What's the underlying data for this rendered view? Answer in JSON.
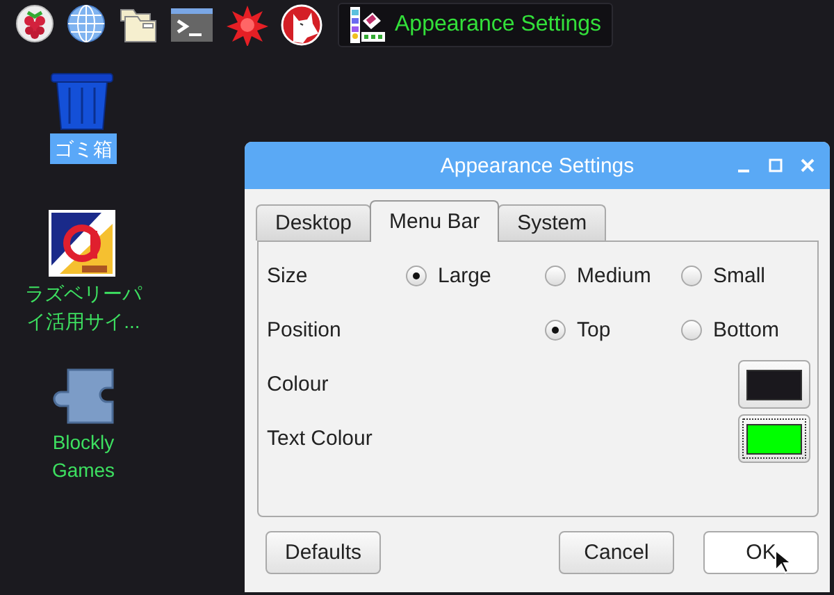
{
  "taskbar": {
    "task": {
      "title": "Appearance Settings"
    }
  },
  "desktop_icons": [
    {
      "label": "ゴミ箱",
      "selected": true
    },
    {
      "label": "ラズベリーパイ活用サイ...",
      "selected": false
    },
    {
      "label": "Blockly Games",
      "selected": false
    }
  ],
  "window": {
    "title": "Appearance Settings",
    "tabs": [
      {
        "label": "Desktop",
        "selected": false
      },
      {
        "label": "Menu Bar",
        "selected": true
      },
      {
        "label": "System",
        "selected": false
      }
    ],
    "rows": [
      {
        "label": "Size",
        "kind": "radio",
        "options": [
          {
            "label": "Large",
            "selected": true
          },
          {
            "label": "Medium",
            "selected": false
          },
          {
            "label": "Small",
            "selected": false
          }
        ]
      },
      {
        "label": "Position",
        "kind": "radio",
        "options": [
          {
            "label": "Top",
            "selected": true
          },
          {
            "label": "Bottom",
            "selected": false
          }
        ]
      },
      {
        "label": "Colour",
        "kind": "color",
        "color": "#1a181d",
        "focused": false
      },
      {
        "label": "Text Colour",
        "kind": "color",
        "color": "#00ff00",
        "focused": true
      }
    ],
    "buttons": [
      {
        "label": "Defaults",
        "highlighted": false
      },
      {
        "label": "Cancel",
        "highlighted": false
      },
      {
        "label": "OK",
        "highlighted": true
      }
    ]
  }
}
